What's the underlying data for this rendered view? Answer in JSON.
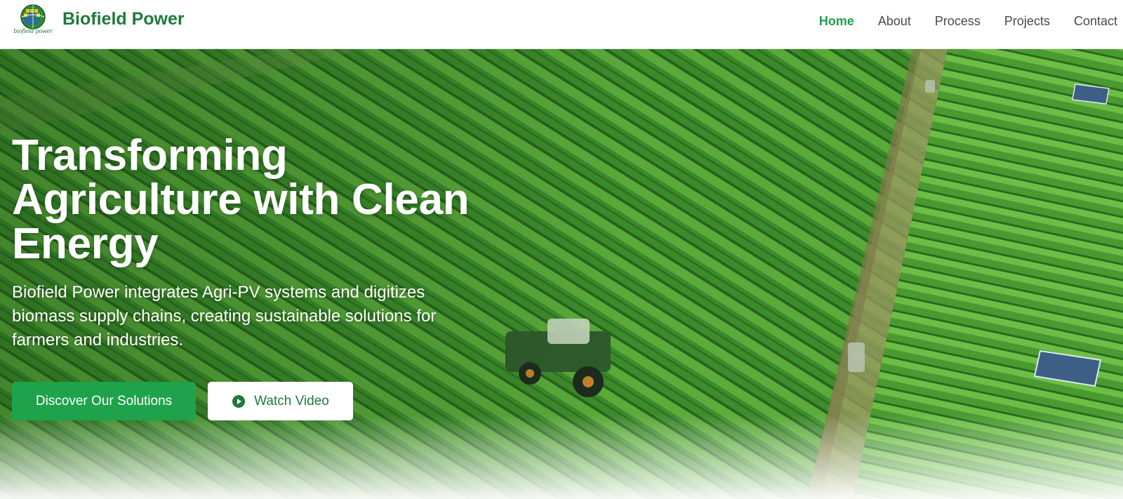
{
  "header": {
    "brand": "Biofield Power",
    "logo_text": "biofield power",
    "nav": [
      {
        "label": "Home",
        "active": true
      },
      {
        "label": "About",
        "active": false
      },
      {
        "label": "Process",
        "active": false
      },
      {
        "label": "Projects",
        "active": false
      },
      {
        "label": "Contact",
        "active": false
      }
    ]
  },
  "hero": {
    "headline": "Transforming Agriculture with Clean Energy",
    "subtext": "Biofield Power integrates Agri-PV systems and digitizes biomass supply chains, creating sustainable solutions for farmers and industries.",
    "primary_button": "Discover Our Solutions",
    "secondary_button": "Watch Video",
    "secondary_button_icon": "play-circle-icon",
    "background_image": "aerial-crop-field-with-tractor-and-solar-panels"
  },
  "colors": {
    "brand_green": "#1e7a3c",
    "accent_green": "#1ea24b",
    "nav_text": "#4a4a4a",
    "field_green": "#3f8b2a"
  }
}
